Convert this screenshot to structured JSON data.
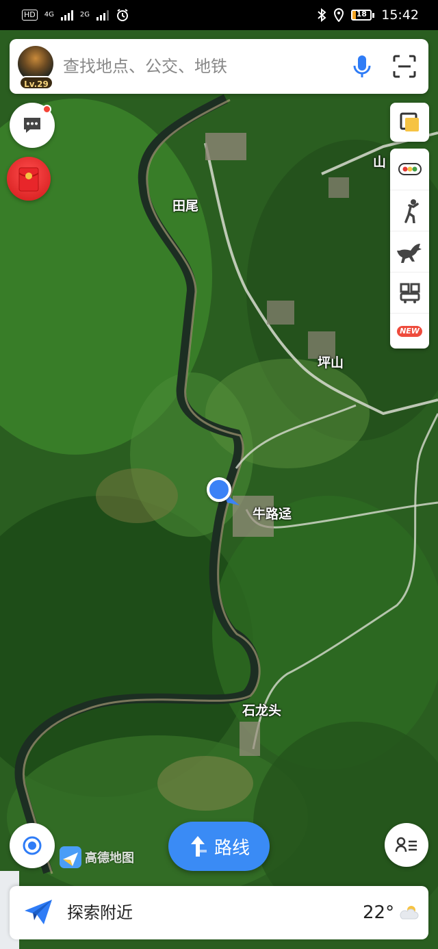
{
  "status_bar": {
    "hd": "HD",
    "net1": "4G",
    "net2": "2G",
    "battery": "18",
    "time": "15:42"
  },
  "search": {
    "placeholder": "查找地点、公交、地铁",
    "level": "Lv.29"
  },
  "map": {
    "places": {
      "tianwei": "田尾",
      "shan": "山",
      "pingshan": "坪山",
      "niuluijing": "牛路迳",
      "shilongtou": "石龙头"
    },
    "colors": {
      "accent": "#3a8bf5",
      "location_dot": "#3b82f6",
      "badge_red": "#ee4b3c"
    }
  },
  "right_toolbar": {
    "items": [
      {
        "name": "layers-icon"
      },
      {
        "name": "traffic-light-icon"
      },
      {
        "name": "walking-person-icon"
      },
      {
        "name": "horse-icon"
      },
      {
        "name": "bus-qr-icon"
      },
      {
        "name": "new-badge",
        "label": "NEW"
      }
    ]
  },
  "bottom": {
    "logo_text": "高德地图",
    "route_label": "路线",
    "explore_label": "探索附近",
    "temperature": "22°"
  }
}
